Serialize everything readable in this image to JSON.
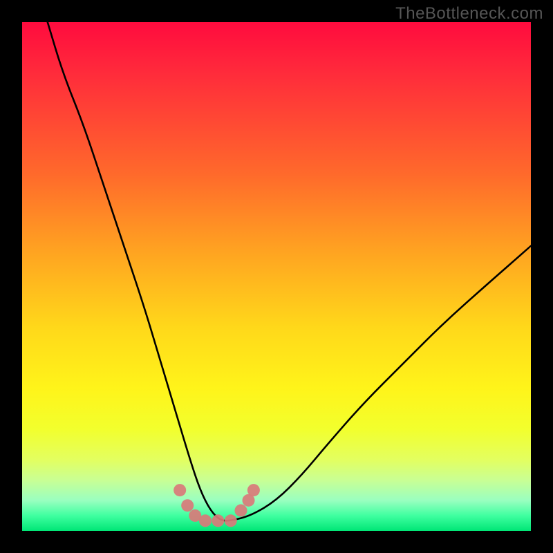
{
  "watermark": "TheBottleneck.com",
  "chart_data": {
    "type": "line",
    "title": "",
    "xlabel": "",
    "ylabel": "",
    "xlim": [
      0,
      100
    ],
    "ylim": [
      0,
      100
    ],
    "series": [
      {
        "name": "bottleneck-curve",
        "x": [
          5,
          8,
          12,
          16,
          20,
          24,
          27,
          30,
          33,
          35,
          37,
          39,
          41,
          45,
          50,
          55,
          60,
          67,
          75,
          83,
          92,
          100
        ],
        "y": [
          100,
          90,
          80,
          68,
          56,
          44,
          34,
          24,
          14,
          8,
          4,
          2,
          2,
          3,
          6,
          11,
          17,
          25,
          33,
          41,
          49,
          56
        ]
      }
    ],
    "marker_points": {
      "comment": "cluster of salmon dots near the trough",
      "x": [
        31,
        32.5,
        34,
        36,
        38.5,
        41,
        43,
        44.5,
        45.5
      ],
      "y": [
        8,
        5,
        3,
        2,
        2,
        2,
        4,
        6,
        8
      ]
    },
    "colors": {
      "curve": "#000000",
      "markers": "#d97a7a",
      "gradient_top": "#ff0b3e",
      "gradient_bottom": "#00e676"
    }
  }
}
